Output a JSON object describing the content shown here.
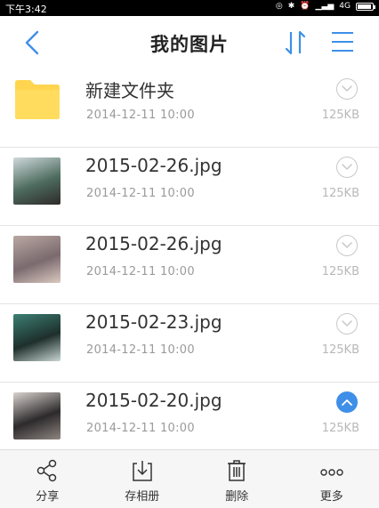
{
  "status_bar": {
    "time": "下午3:42",
    "network": "4G",
    "battery_level": 0.95
  },
  "header": {
    "title": "我的图片"
  },
  "items": [
    {
      "type": "folder",
      "name": "新建文件夹",
      "date": "2014-12-11  10:00",
      "size": "125KB",
      "selected": false
    },
    {
      "type": "image",
      "name": "2015-02-26.jpg",
      "date": "2014-12-11  10:00",
      "size": "125KB",
      "selected": false,
      "thumb_colors": [
        "#cfd9dc",
        "#4d6b5e",
        "#2e2a2a"
      ]
    },
    {
      "type": "image",
      "name": "2015-02-26.jpg",
      "date": "2014-12-11  10:00",
      "size": "125KB",
      "selected": false,
      "thumb_colors": [
        "#b9a8a2",
        "#7b6a6e",
        "#d9c9c0"
      ]
    },
    {
      "type": "image",
      "name": "2015-02-23.jpg",
      "date": "2014-12-11  10:00",
      "size": "125KB",
      "selected": false,
      "thumb_colors": [
        "#3c7f74",
        "#1e2f2c",
        "#c9d6d2"
      ]
    },
    {
      "type": "image",
      "name": "2015-02-20.jpg",
      "date": "2014-12-11  10:00",
      "size": "125KB",
      "selected": true,
      "thumb_colors": [
        "#d9d3cf",
        "#2d2a2c",
        "#8e8580"
      ]
    }
  ],
  "toolbar": {
    "share": "分享",
    "save_album": "存相册",
    "delete": "删除",
    "more": "更多"
  },
  "colors": {
    "accent": "#3f8fe8",
    "folder": "#ffd54f"
  }
}
